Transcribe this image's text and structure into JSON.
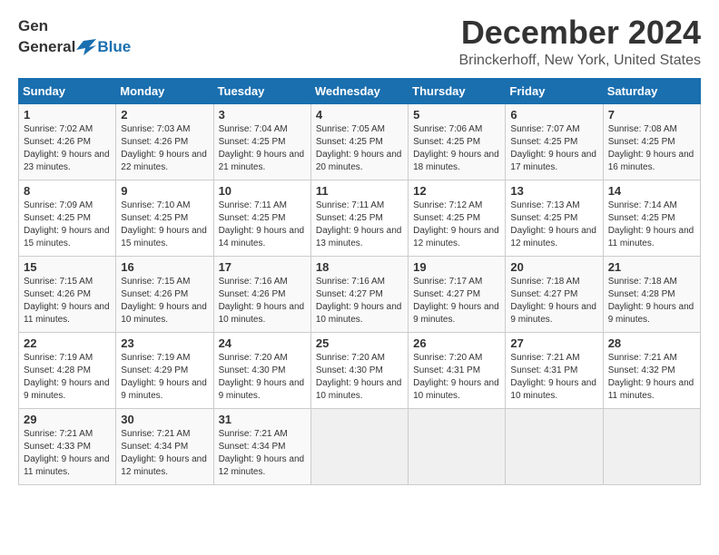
{
  "header": {
    "logo_general": "General",
    "logo_blue": "Blue",
    "month_title": "December 2024",
    "location": "Brinckerhoff, New York, United States"
  },
  "days_of_week": [
    "Sunday",
    "Monday",
    "Tuesday",
    "Wednesday",
    "Thursday",
    "Friday",
    "Saturday"
  ],
  "weeks": [
    [
      {
        "day": "1",
        "sunrise": "7:02 AM",
        "sunset": "4:26 PM",
        "daylight": "9 hours and 23 minutes."
      },
      {
        "day": "2",
        "sunrise": "7:03 AM",
        "sunset": "4:26 PM",
        "daylight": "9 hours and 22 minutes."
      },
      {
        "day": "3",
        "sunrise": "7:04 AM",
        "sunset": "4:25 PM",
        "daylight": "9 hours and 21 minutes."
      },
      {
        "day": "4",
        "sunrise": "7:05 AM",
        "sunset": "4:25 PM",
        "daylight": "9 hours and 20 minutes."
      },
      {
        "day": "5",
        "sunrise": "7:06 AM",
        "sunset": "4:25 PM",
        "daylight": "9 hours and 18 minutes."
      },
      {
        "day": "6",
        "sunrise": "7:07 AM",
        "sunset": "4:25 PM",
        "daylight": "9 hours and 17 minutes."
      },
      {
        "day": "7",
        "sunrise": "7:08 AM",
        "sunset": "4:25 PM",
        "daylight": "9 hours and 16 minutes."
      }
    ],
    [
      {
        "day": "8",
        "sunrise": "7:09 AM",
        "sunset": "4:25 PM",
        "daylight": "9 hours and 15 minutes."
      },
      {
        "day": "9",
        "sunrise": "7:10 AM",
        "sunset": "4:25 PM",
        "daylight": "9 hours and 15 minutes."
      },
      {
        "day": "10",
        "sunrise": "7:11 AM",
        "sunset": "4:25 PM",
        "daylight": "9 hours and 14 minutes."
      },
      {
        "day": "11",
        "sunrise": "7:11 AM",
        "sunset": "4:25 PM",
        "daylight": "9 hours and 13 minutes."
      },
      {
        "day": "12",
        "sunrise": "7:12 AM",
        "sunset": "4:25 PM",
        "daylight": "9 hours and 12 minutes."
      },
      {
        "day": "13",
        "sunrise": "7:13 AM",
        "sunset": "4:25 PM",
        "daylight": "9 hours and 12 minutes."
      },
      {
        "day": "14",
        "sunrise": "7:14 AM",
        "sunset": "4:25 PM",
        "daylight": "9 hours and 11 minutes."
      }
    ],
    [
      {
        "day": "15",
        "sunrise": "7:15 AM",
        "sunset": "4:26 PM",
        "daylight": "9 hours and 11 minutes."
      },
      {
        "day": "16",
        "sunrise": "7:15 AM",
        "sunset": "4:26 PM",
        "daylight": "9 hours and 10 minutes."
      },
      {
        "day": "17",
        "sunrise": "7:16 AM",
        "sunset": "4:26 PM",
        "daylight": "9 hours and 10 minutes."
      },
      {
        "day": "18",
        "sunrise": "7:16 AM",
        "sunset": "4:27 PM",
        "daylight": "9 hours and 10 minutes."
      },
      {
        "day": "19",
        "sunrise": "7:17 AM",
        "sunset": "4:27 PM",
        "daylight": "9 hours and 9 minutes."
      },
      {
        "day": "20",
        "sunrise": "7:18 AM",
        "sunset": "4:27 PM",
        "daylight": "9 hours and 9 minutes."
      },
      {
        "day": "21",
        "sunrise": "7:18 AM",
        "sunset": "4:28 PM",
        "daylight": "9 hours and 9 minutes."
      }
    ],
    [
      {
        "day": "22",
        "sunrise": "7:19 AM",
        "sunset": "4:28 PM",
        "daylight": "9 hours and 9 minutes."
      },
      {
        "day": "23",
        "sunrise": "7:19 AM",
        "sunset": "4:29 PM",
        "daylight": "9 hours and 9 minutes."
      },
      {
        "day": "24",
        "sunrise": "7:20 AM",
        "sunset": "4:30 PM",
        "daylight": "9 hours and 9 minutes."
      },
      {
        "day": "25",
        "sunrise": "7:20 AM",
        "sunset": "4:30 PM",
        "daylight": "9 hours and 10 minutes."
      },
      {
        "day": "26",
        "sunrise": "7:20 AM",
        "sunset": "4:31 PM",
        "daylight": "9 hours and 10 minutes."
      },
      {
        "day": "27",
        "sunrise": "7:21 AM",
        "sunset": "4:31 PM",
        "daylight": "9 hours and 10 minutes."
      },
      {
        "day": "28",
        "sunrise": "7:21 AM",
        "sunset": "4:32 PM",
        "daylight": "9 hours and 11 minutes."
      }
    ],
    [
      {
        "day": "29",
        "sunrise": "7:21 AM",
        "sunset": "4:33 PM",
        "daylight": "9 hours and 11 minutes."
      },
      {
        "day": "30",
        "sunrise": "7:21 AM",
        "sunset": "4:34 PM",
        "daylight": "9 hours and 12 minutes."
      },
      {
        "day": "31",
        "sunrise": "7:21 AM",
        "sunset": "4:34 PM",
        "daylight": "9 hours and 12 minutes."
      },
      null,
      null,
      null,
      null
    ]
  ],
  "labels": {
    "sunrise": "Sunrise:",
    "sunset": "Sunset:",
    "daylight": "Daylight:"
  }
}
